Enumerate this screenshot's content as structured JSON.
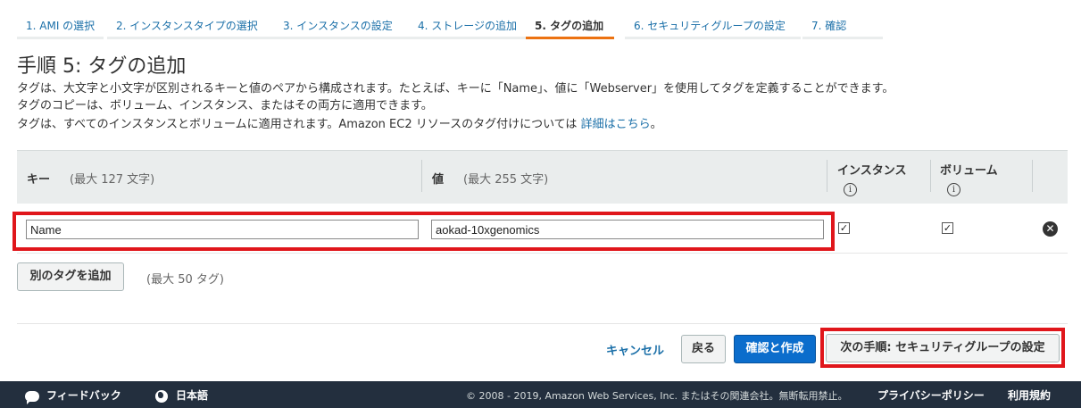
{
  "wizard": {
    "steps": [
      {
        "label": "1. AMI の選択"
      },
      {
        "label": "2. インスタンスタイプの選択"
      },
      {
        "label": "3. インスタンスの設定"
      },
      {
        "label": "4. ストレージの追加"
      },
      {
        "label": "5. タグの追加"
      },
      {
        "label": "6. セキュリティグループの設定"
      },
      {
        "label": "7. 確認"
      }
    ],
    "active_step": 5
  },
  "page": {
    "title": "手順 5: タグの追加",
    "desc1": "タグは、大文字と小文字が区別されるキーと値のペアから構成されます。たとえば、キーに「Name」、値に「Webserver」を使用してタグを定義することができます。",
    "desc2": "タグのコピーは、ボリューム、インスタンス、またはその両方に適用できます。",
    "desc3": "タグは、すべてのインスタンスとボリュームに適用されます。Amazon EC2 リソースのタグ付けについては",
    "desc3_link": "詳細はこちら",
    "desc3_end": "。"
  },
  "table": {
    "key_header": "キー",
    "key_hint": "(最大 127 文字)",
    "value_header": "値",
    "value_hint": "(最大 255 文字)",
    "instance_header": "インスタンス",
    "volume_header": "ボリューム",
    "info_glyph": "i",
    "rows": [
      {
        "key": "Name",
        "value": "aokad-10xgenomics",
        "instance": true,
        "volume": true
      }
    ],
    "check_glyph": "✓",
    "remove_glyph": "✕"
  },
  "add_tag": {
    "button_label": "別のタグを追加",
    "limit": "(最大 50 タグ)"
  },
  "actions": {
    "cancel": "キャンセル",
    "back": "戻る",
    "review_launch": "確認と作成",
    "next": "次の手順: セキュリティグループの設定"
  },
  "footer": {
    "feedback": "フィードバック",
    "language": "日本語",
    "copyright": "© 2008 - 2019, Amazon Web Services, Inc. またはその関連会社。無断転用禁止。",
    "privacy": "プライバシーポリシー",
    "terms": "利用規約"
  },
  "colors": {
    "accent": "#ec7211",
    "link": "#1a6fa8",
    "primary_button": "#0b6dcc",
    "highlight_box": "#e0161b",
    "footer_bg": "#232f3e"
  }
}
